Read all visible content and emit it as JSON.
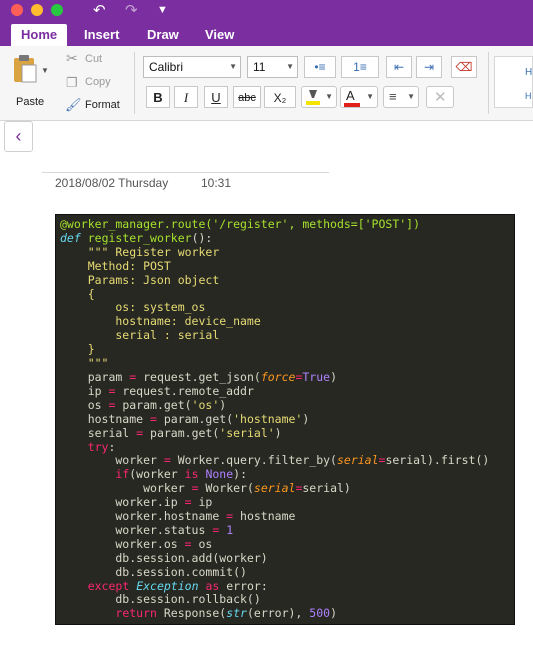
{
  "titlebar": {
    "undo_icon": "undo-icon",
    "redo_icon": "redo-icon",
    "customize_icon": "customize-icon"
  },
  "tabs": [
    "Home",
    "Insert",
    "Draw",
    "View"
  ],
  "ribbon": {
    "paste": "Paste",
    "cut": "Cut",
    "copy": "Copy",
    "format": "Format",
    "font_name": "Calibri",
    "font_size": "11",
    "bold": "B",
    "italic": "I",
    "underline": "U",
    "strike": "abc",
    "subscript": "X₂",
    "highlight_color": "#f5e400",
    "font_color": "#e0201b"
  },
  "note": {
    "date": "2018/08/02 Thursday",
    "time": "10:31"
  },
  "colors": {
    "accent": "#7b2ea0",
    "code_bg": "#272822"
  },
  "code": {
    "lines": [
      "@worker_manager.route('/register', methods=['POST'])",
      "def register_worker():",
      "    \"\"\" Register worker",
      "    Method: POST",
      "    Params: Json object",
      "    {",
      "        os: system_os",
      "        hostname: device_name",
      "        serial : serial",
      "    }",
      "    \"\"\"",
      "    param = request.get_json(force=True)",
      "    ip = request.remote_addr",
      "    os = param.get('os')",
      "    hostname = param.get('hostname')",
      "    serial = param.get('serial')",
      "    try:",
      "        worker = Worker.query.filter_by(serial=serial).first()",
      "        if(worker is None):",
      "            worker = Worker(serial=serial)",
      "        worker.ip = ip",
      "        worker.hostname = hostname",
      "        worker.status = 1",
      "        worker.os = os",
      "        db.session.add(worker)",
      "        db.session.commit()",
      "    except Exception as error:",
      "        db.session.rollback()",
      "        return Response(str(error), 500)"
    ]
  }
}
